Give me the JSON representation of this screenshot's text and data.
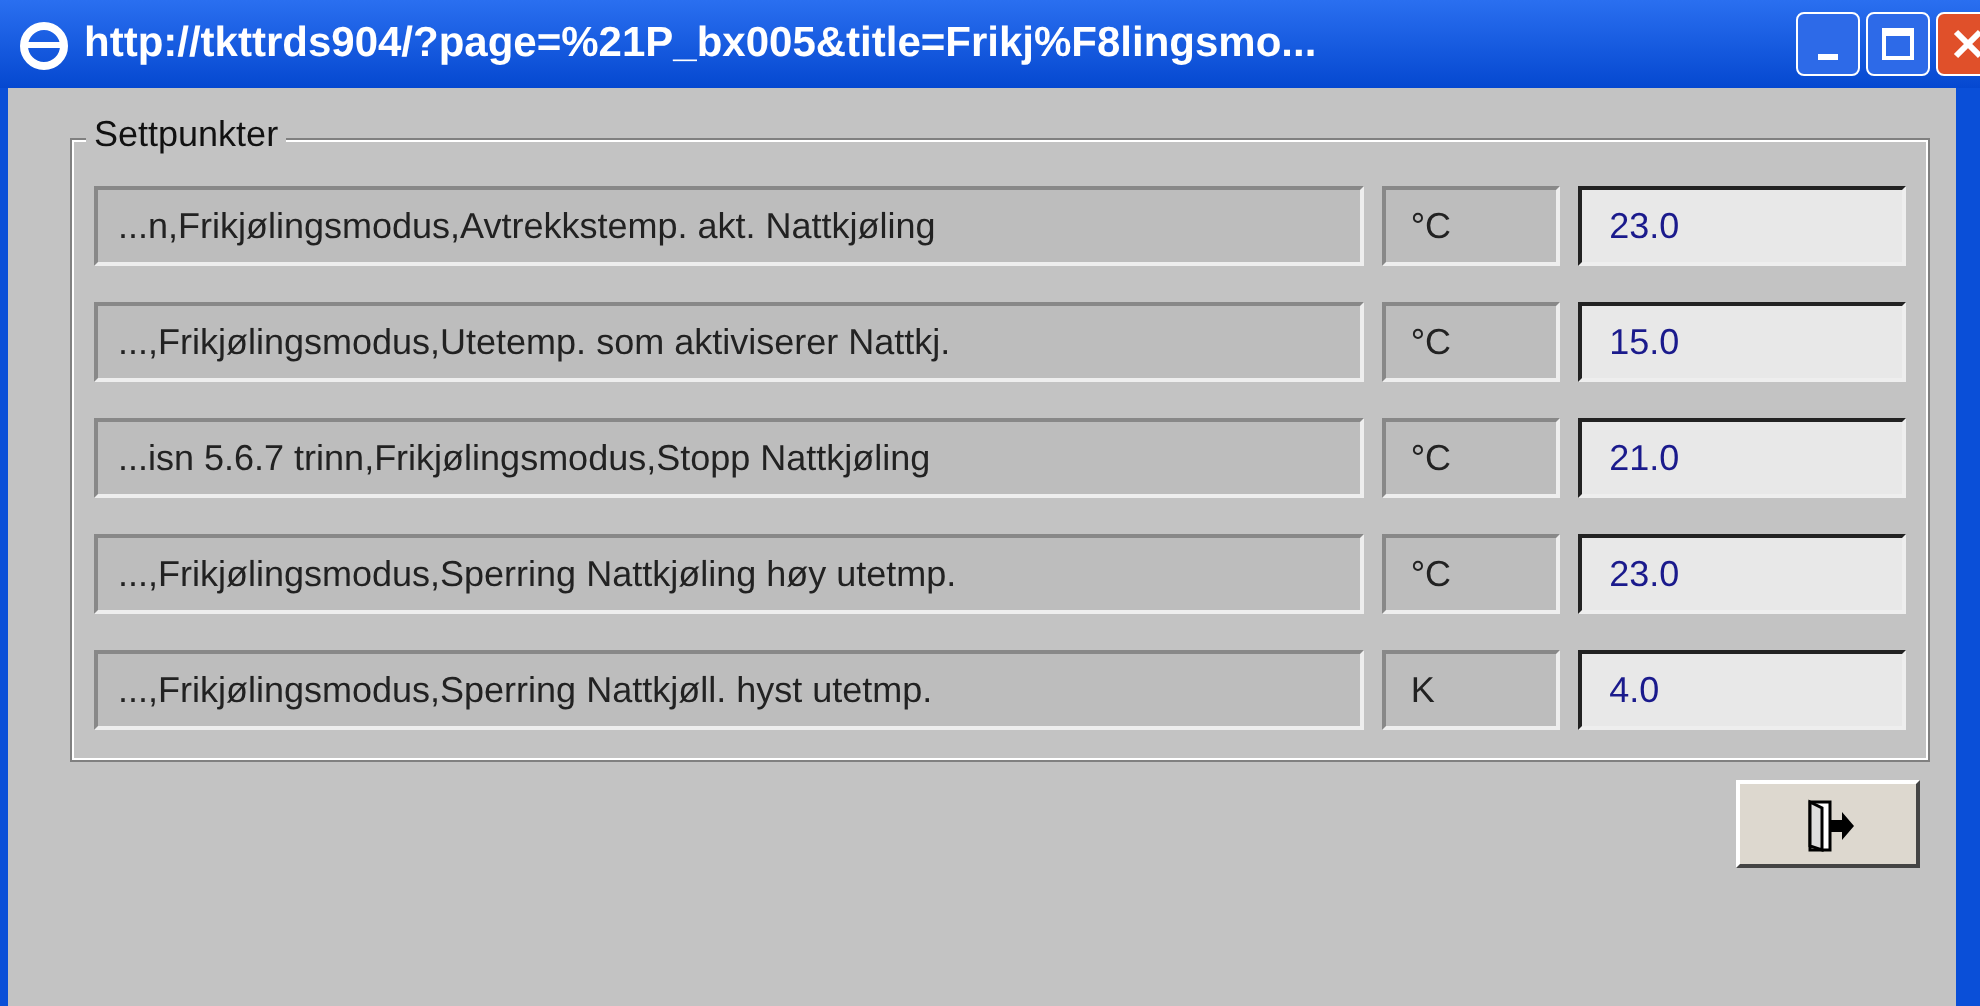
{
  "window": {
    "title": "http://tkttrds904/?page=%21P_bx005&title=Frikj%F8lingsmo..."
  },
  "group": {
    "title": "Settpunkter"
  },
  "rows": [
    {
      "label": "...n,Frikjølingsmodus,Avtrekkstemp. akt. Nattkjøling",
      "unit": "°C",
      "value": "23.0"
    },
    {
      "label": "...,Frikjølingsmodus,Utetemp. som aktiviserer Nattkj.",
      "unit": "°C",
      "value": "15.0"
    },
    {
      "label": "...isn 5.6.7 trinn,Frikjølingsmodus,Stopp Nattkjøling",
      "unit": "°C",
      "value": "21.0"
    },
    {
      "label": "...,Frikjølingsmodus,Sperring Nattkjøling høy utetmp.",
      "unit": "°C",
      "value": "23.0"
    },
    {
      "label": "...,Frikjølingsmodus,Sperring Nattkjøll. hyst utetmp.",
      "unit": "K",
      "value": "4.0"
    }
  ]
}
